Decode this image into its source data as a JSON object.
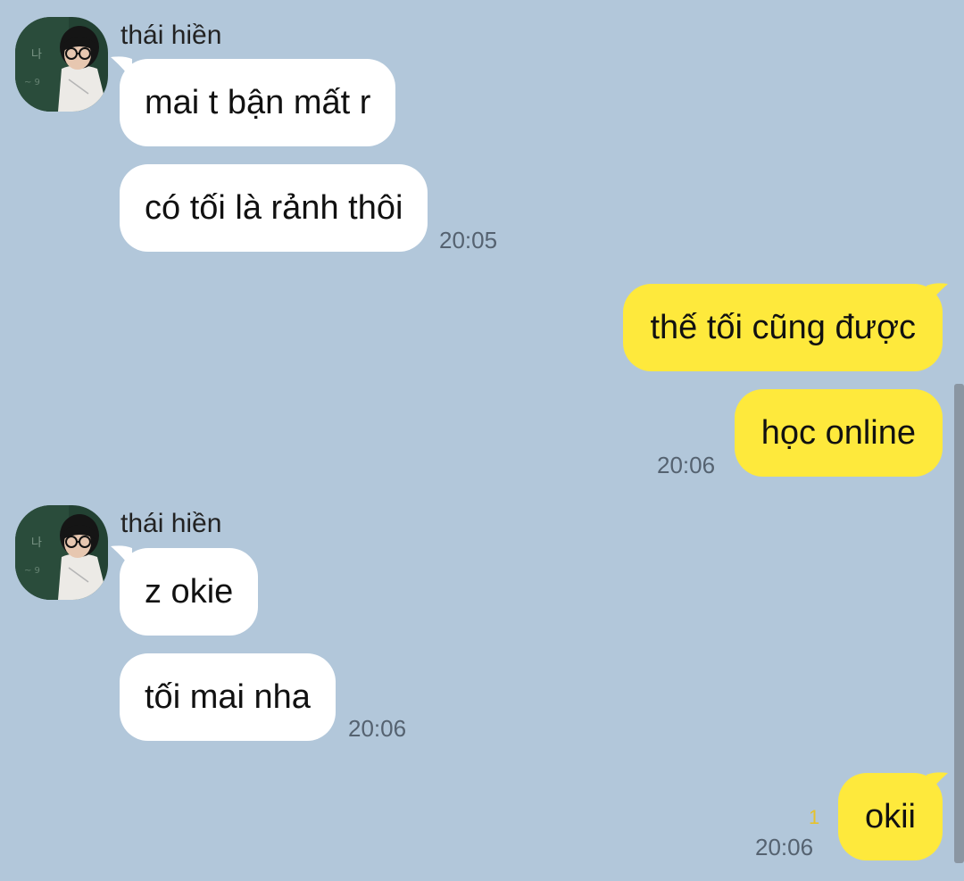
{
  "colors": {
    "background": "#b2c7da",
    "incoming_bubble": "#ffffff",
    "outgoing_bubble": "#fee93c",
    "timestamp": "#556270",
    "unread_count": "#e6c22a"
  },
  "messages": {
    "group1": {
      "sender": "thái hiền",
      "avatar_icon": "profile-photo-avatar",
      "bubble1": "mai t bận mất r",
      "bubble2": "có tối là rảnh thôi",
      "time": "20:05"
    },
    "out1": {
      "bubble1": "thế tối cũng được",
      "bubble2": "học online",
      "time": "20:06"
    },
    "group2": {
      "sender": "thái hiền",
      "avatar_icon": "profile-photo-avatar",
      "bubble1": "z okie",
      "bubble2": "tối mai nha",
      "time": "20:06"
    },
    "out2": {
      "bubble1": "okii",
      "unread": "1",
      "time": "20:06"
    }
  }
}
